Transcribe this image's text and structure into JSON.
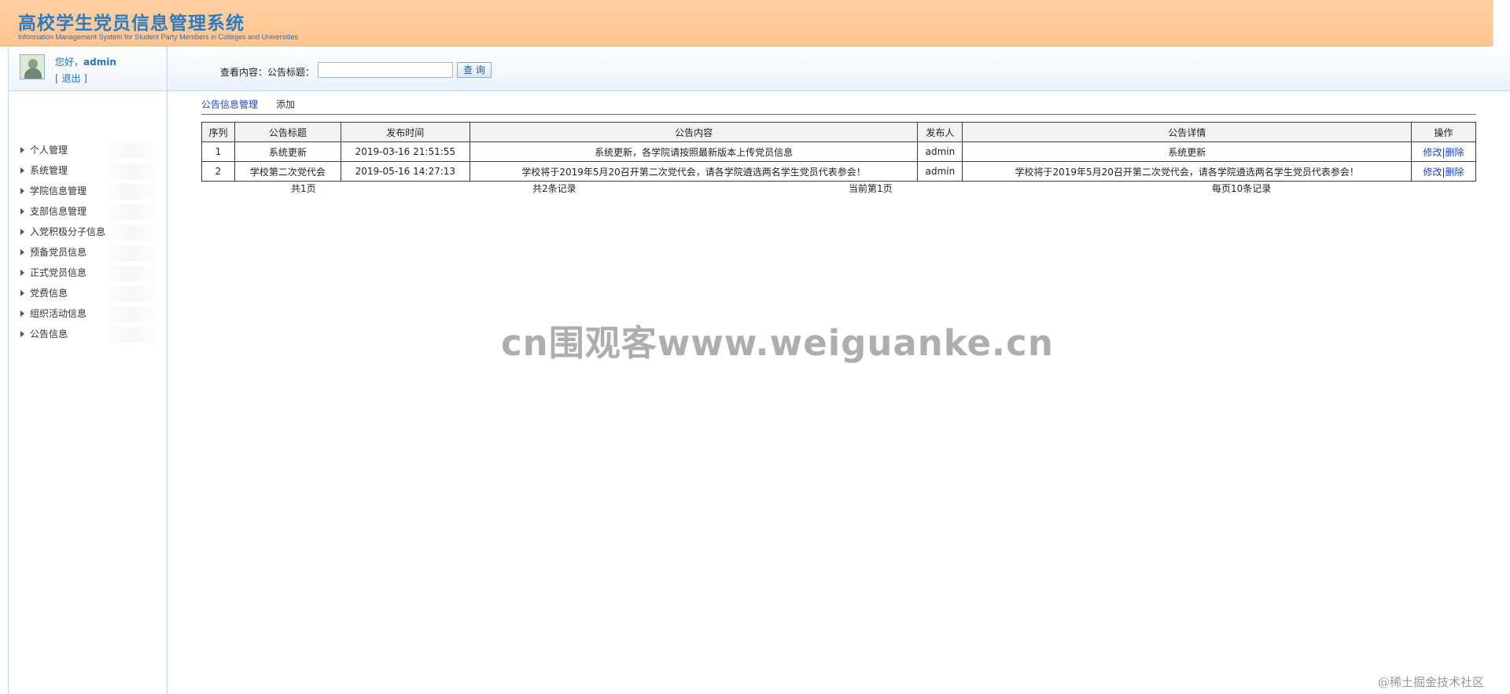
{
  "header": {
    "title": "高校学生党员信息管理系统",
    "subtitle": "Information Management System for Student Party Members in Colleges and Universities"
  },
  "user": {
    "greeting": "您好，",
    "name": "admin",
    "logout": "[ 退出 ]"
  },
  "sidebar": {
    "items": [
      {
        "label": "个人管理"
      },
      {
        "label": "系统管理"
      },
      {
        "label": "学院信息管理"
      },
      {
        "label": "支部信息管理"
      },
      {
        "label": "入党积极分子信息"
      },
      {
        "label": "预备党员信息"
      },
      {
        "label": "正式党员信息"
      },
      {
        "label": "党费信息"
      },
      {
        "label": "组织活动信息"
      },
      {
        "label": "公告信息"
      }
    ]
  },
  "search": {
    "label": "查看内容：公告标题：",
    "value": "",
    "button": "查 询"
  },
  "tabs": {
    "manage": "公告信息管理",
    "add": "添加"
  },
  "table": {
    "columns": [
      "序列",
      "公告标题",
      "发布时间",
      "公告内容",
      "发布人",
      "公告详情",
      "操作"
    ],
    "rows": [
      {
        "index": "1",
        "title": "系统更新",
        "time": "2019-03-16 21:51:55",
        "content": "系统更新，各学院请按照最新版本上传党员信息",
        "publisher": "admin",
        "detail": "系统更新",
        "edit": "修改",
        "sep": "|",
        "delete": "删除"
      },
      {
        "index": "2",
        "title": "学校第二次党代会",
        "time": "2019-05-16 14:27:13",
        "content": "学校将于2019年5月20召开第二次党代会，请各学院遴选两名学生党员代表参会！",
        "publisher": "admin",
        "detail": "学校将于2019年5月20召开第二次党代会，请各学院遴选两名学生党员代表参会！",
        "edit": "修改",
        "sep": "|",
        "delete": "删除"
      }
    ]
  },
  "pager": {
    "total_pages": "共1页",
    "total_records": "共2条记录",
    "current": "当前第1页",
    "per_page": "每页10条记录"
  },
  "watermarks": {
    "center": "cn围观客www.weiguanke.cn",
    "corner": "@稀土掘金技术社区"
  }
}
